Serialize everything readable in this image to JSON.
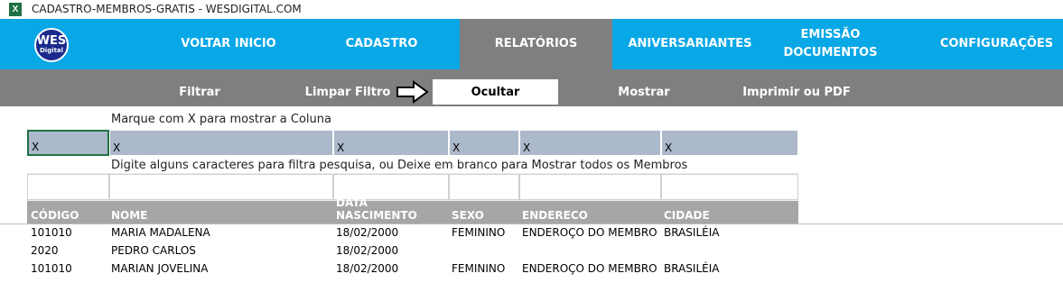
{
  "window": {
    "app_icon": "excel-icon",
    "title": "CADASTRO-MEMBROS-GRATIS - WESDIGITAL.COM"
  },
  "logo": {
    "line1": "WES",
    "line2": "Digital"
  },
  "nav": [
    {
      "label": "VOLTAR INICIO"
    },
    {
      "label": "CADASTRO"
    },
    {
      "label": "RELATÓRIOS",
      "active": true
    },
    {
      "label": "ANIVERSARIANTES"
    },
    {
      "label": "EMISSÃO DOCUMENTOS"
    },
    {
      "label": "CONFIGURAÇÕES"
    }
  ],
  "subnav": [
    {
      "label": "Filtrar"
    },
    {
      "label": "Limpar Filtro"
    },
    {
      "label": "Ocultar",
      "active": true
    },
    {
      "label": "Mostrar"
    },
    {
      "label": "Imprimir ou PDF"
    }
  ],
  "instructions": {
    "show_columns": "Marque com X para mostrar a Coluna",
    "filter": "Digite alguns caracteres para filtra pesquisa, ou Deixe em branco para Mostrar todos os Membros"
  },
  "column_marks": [
    "X",
    "X",
    "X",
    "X",
    "X",
    "X"
  ],
  "filter_values": [
    "",
    "",
    "",
    "",
    "",
    ""
  ],
  "table": {
    "headers": [
      "CÓDIGO",
      "NOME",
      "DATA NASCIMENTO",
      "SEXO",
      "ENDERECO",
      "CIDADE"
    ],
    "rows": [
      [
        "101010",
        "MARIA MADALENA",
        "18/02/2000",
        "FEMININO",
        "ENDEROÇO DO MEMBRO",
        "BRASILÉIA"
      ],
      [
        "2020",
        "PEDRO CARLOS",
        "18/02/2000",
        "",
        "",
        ""
      ],
      [
        "101010",
        "MARIAN JOVELINA",
        "18/02/2000",
        "FEMININO",
        "ENDEROÇO DO MEMBRO",
        "BRASILÉIA"
      ]
    ]
  },
  "colors": {
    "nav_bg": "#08a7e6",
    "nav_active": "#7f7f7f",
    "subnav_bg": "#7f7f7f",
    "mark_cell": "#acb9ca",
    "header_bg": "#a6a6a6"
  }
}
